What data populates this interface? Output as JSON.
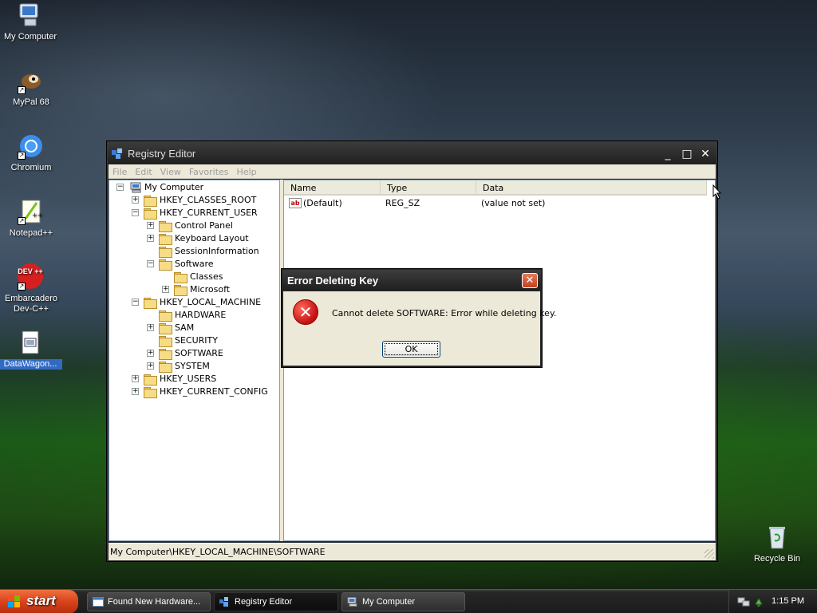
{
  "desktop": {
    "icons": [
      {
        "label": "My Computer"
      },
      {
        "label": "MyPal 68"
      },
      {
        "label": "Chromium"
      },
      {
        "label": "Notepad++"
      },
      {
        "label": "Embarcadero Dev-C++",
        "line1": "Embarcadero",
        "line2": "Dev-C++",
        "badge": "DEV ++"
      },
      {
        "label": "DataWagon..."
      },
      {
        "label": "Recycle Bin"
      }
    ]
  },
  "regedit": {
    "title": "Registry Editor",
    "menu": [
      "File",
      "Edit",
      "View",
      "Favorites",
      "Help"
    ],
    "window_controls": {
      "minimize": "_",
      "maximize": "□",
      "close": "✕"
    },
    "tree": [
      {
        "label": "My Computer",
        "expander": "−"
      },
      {
        "label": "HKEY_CLASSES_ROOT",
        "expander": "+"
      },
      {
        "label": "HKEY_CURRENT_USER",
        "expander": "−"
      },
      {
        "label": "Control Panel",
        "expander": "+"
      },
      {
        "label": "Keyboard Layout",
        "expander": "+"
      },
      {
        "label": "SessionInformation",
        "expander": ""
      },
      {
        "label": "Software",
        "expander": "−"
      },
      {
        "label": "Classes",
        "expander": ""
      },
      {
        "label": "Microsoft",
        "expander": "+"
      },
      {
        "label": "HKEY_LOCAL_MACHINE",
        "expander": "−"
      },
      {
        "label": "HARDWARE",
        "expander": ""
      },
      {
        "label": "SAM",
        "expander": "+"
      },
      {
        "label": "SECURITY",
        "expander": ""
      },
      {
        "label": "SOFTWARE",
        "expander": "+"
      },
      {
        "label": "SYSTEM",
        "expander": "+"
      },
      {
        "label": "HKEY_USERS",
        "expander": "+"
      },
      {
        "label": "HKEY_CURRENT_CONFIG",
        "expander": "+"
      }
    ],
    "columns": [
      "Name",
      "Type",
      "Data"
    ],
    "values": [
      {
        "name": "(Default)",
        "type": "REG_SZ",
        "data": "(value not set)",
        "icon": "ab"
      }
    ],
    "status": "My Computer\\HKEY_LOCAL_MACHINE\\SOFTWARE"
  },
  "dialog": {
    "title": "Error Deleting Key",
    "close": "✕",
    "message": "Cannot delete SOFTWARE:  Error while deleting key.",
    "ok_label": "OK",
    "icon": "error-icon"
  },
  "taskbar": {
    "start_label": "start",
    "tasks": [
      {
        "label": "Found New Hardware..."
      },
      {
        "label": "Registry Editor"
      },
      {
        "label": "My Computer"
      }
    ],
    "clock": "1:15 PM"
  }
}
